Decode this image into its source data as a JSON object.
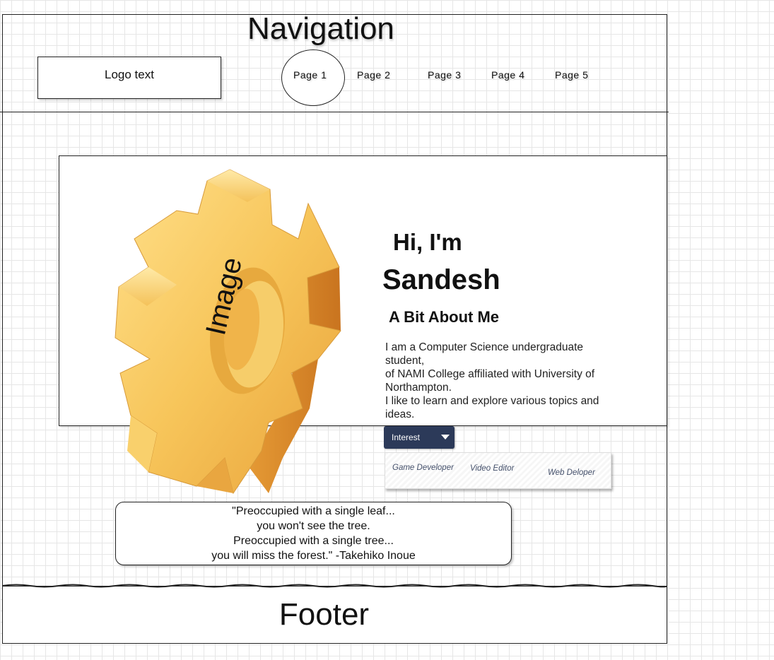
{
  "navigation": {
    "title": "Navigation",
    "logo_text": "Logo text",
    "links": [
      "Page 1",
      "Page 2",
      "Page 3",
      "Page 4",
      "Page 5"
    ]
  },
  "hero": {
    "image_label": "Image",
    "greeting": "Hi, I'm",
    "name": "Sandesh",
    "about_title": "A Bit About Me",
    "about_lines": [
      "I am a Computer Science undergraduate student,",
      "of NAMI College affiliated with University of Northampton.",
      "I like to learn and explore various topics and ideas."
    ],
    "gear_color": "#f2b944"
  },
  "interest": {
    "button_label": "Interest",
    "items": [
      "Game Developer",
      "Video Editor",
      "Web Deloper"
    ]
  },
  "quote": {
    "lines": [
      "\"Preoccupied with a single leaf...",
      "you won't see the tree.",
      "Preoccupied with a single tree...",
      "you will miss the forest.\" -Takehiko Inoue"
    ]
  },
  "footer": {
    "title": "Footer"
  }
}
